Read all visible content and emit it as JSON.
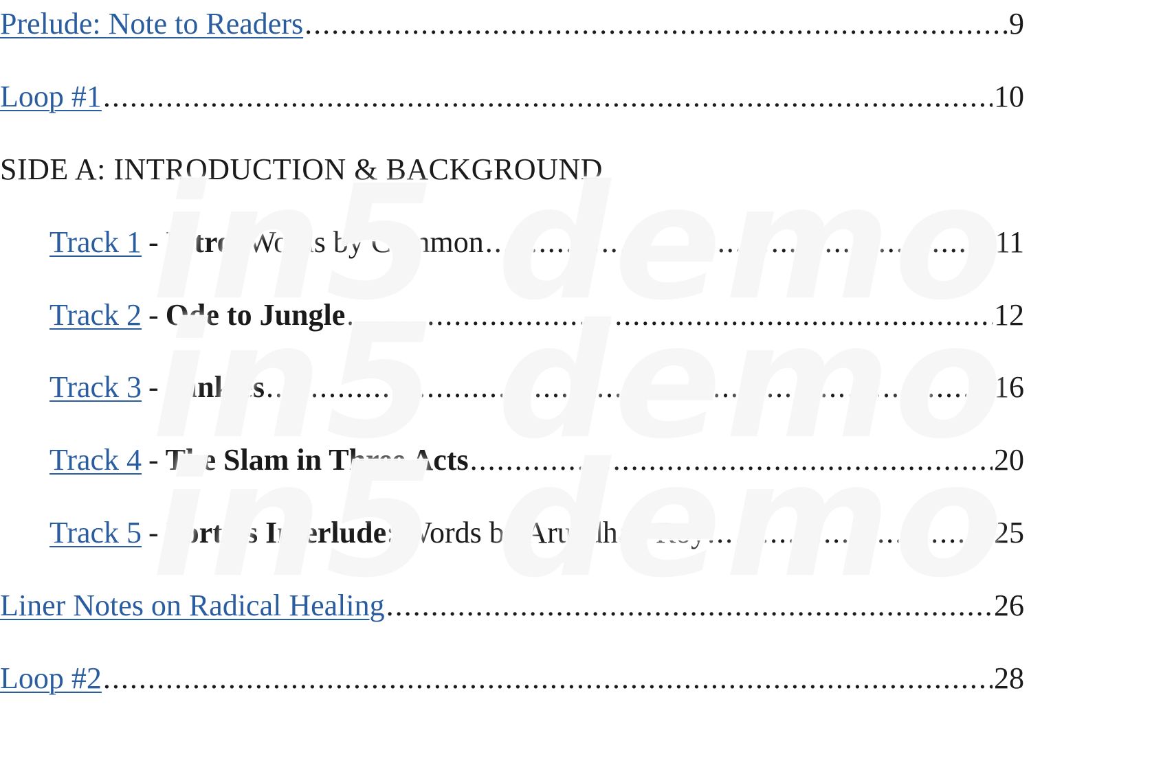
{
  "toc": {
    "prelude": {
      "label": "Prelude: Note to Readers",
      "page": "9"
    },
    "loop1": {
      "label": "Loop #1",
      "page": "10"
    },
    "side_a_heading": "SIDE A: INTRODUCTION & BACKGROUND",
    "tracks": [
      {
        "link": "Track 1",
        "sep": "-",
        "bold": "Intro",
        "rest": ": Words by Common",
        "page": "11"
      },
      {
        "link": "Track 2",
        "sep": "-",
        "bold": "Ode to Jungle",
        "rest": "",
        "page": "12"
      },
      {
        "link": "Track 3",
        "sep": "-",
        "bold": "Junkies",
        "rest": "",
        "page": "16"
      },
      {
        "link": "Track 4",
        "sep": "-",
        "bold": "The Slam in Three Acts",
        "rest": "",
        "page": "20"
      },
      {
        "link": "Track 5",
        "sep": "-",
        "bold": "Portals Interlude:",
        "rest": " Words by Arundhati Roy",
        "page": "25"
      }
    ],
    "liner_notes": {
      "label": "Liner Notes on Radical Healing",
      "page": "26"
    },
    "loop2": {
      "label": "Loop #2",
      "page": "28"
    }
  },
  "watermark": {
    "lines": [
      "in5 demo",
      "in5 demo",
      "in5 demo"
    ]
  }
}
